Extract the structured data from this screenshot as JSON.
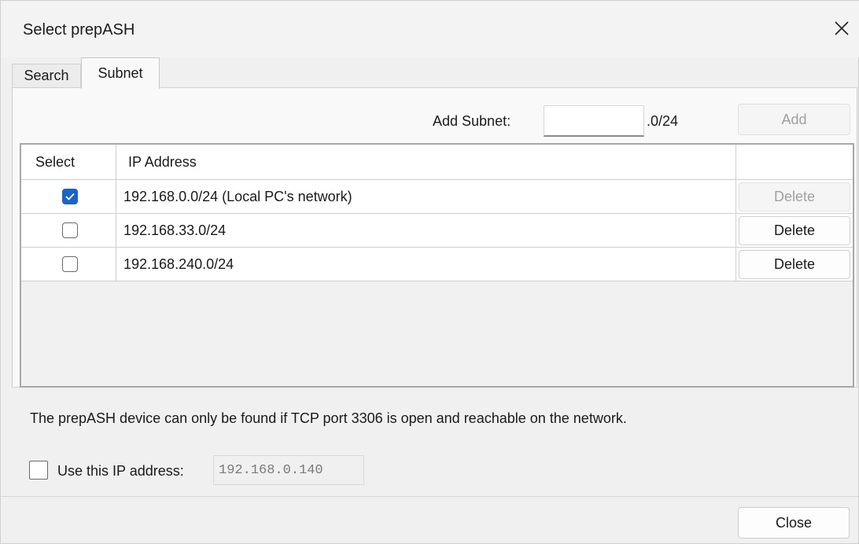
{
  "dialog": {
    "title": "Select prepASH",
    "close_icon": "close-icon"
  },
  "tabs": [
    {
      "label": "Search",
      "active": false
    },
    {
      "label": "Subnet",
      "active": true
    }
  ],
  "add_subnet": {
    "label": "Add Subnet:",
    "value": "",
    "suffix": ".0/24",
    "button_label": "Add",
    "button_enabled": false
  },
  "table": {
    "columns": [
      "Select",
      "IP Address",
      ""
    ],
    "rows": [
      {
        "checked": true,
        "ip": "192.168.0.0/24 (Local PC's network)",
        "delete_label": "Delete",
        "delete_enabled": false
      },
      {
        "checked": false,
        "ip": "192.168.33.0/24",
        "delete_label": "Delete",
        "delete_enabled": true
      },
      {
        "checked": false,
        "ip": "192.168.240.0/24",
        "delete_label": "Delete",
        "delete_enabled": true
      }
    ]
  },
  "info_text": "The prepASH device can only be found if TCP port 3306 is open and reachable on the network.",
  "use_ip": {
    "checked": false,
    "label": "Use this IP address:",
    "value": "192.168.0.140"
  },
  "footer": {
    "close_label": "Close"
  },
  "colors": {
    "accent": "#1a63c7",
    "dialog_bg": "#f0f0f0"
  }
}
